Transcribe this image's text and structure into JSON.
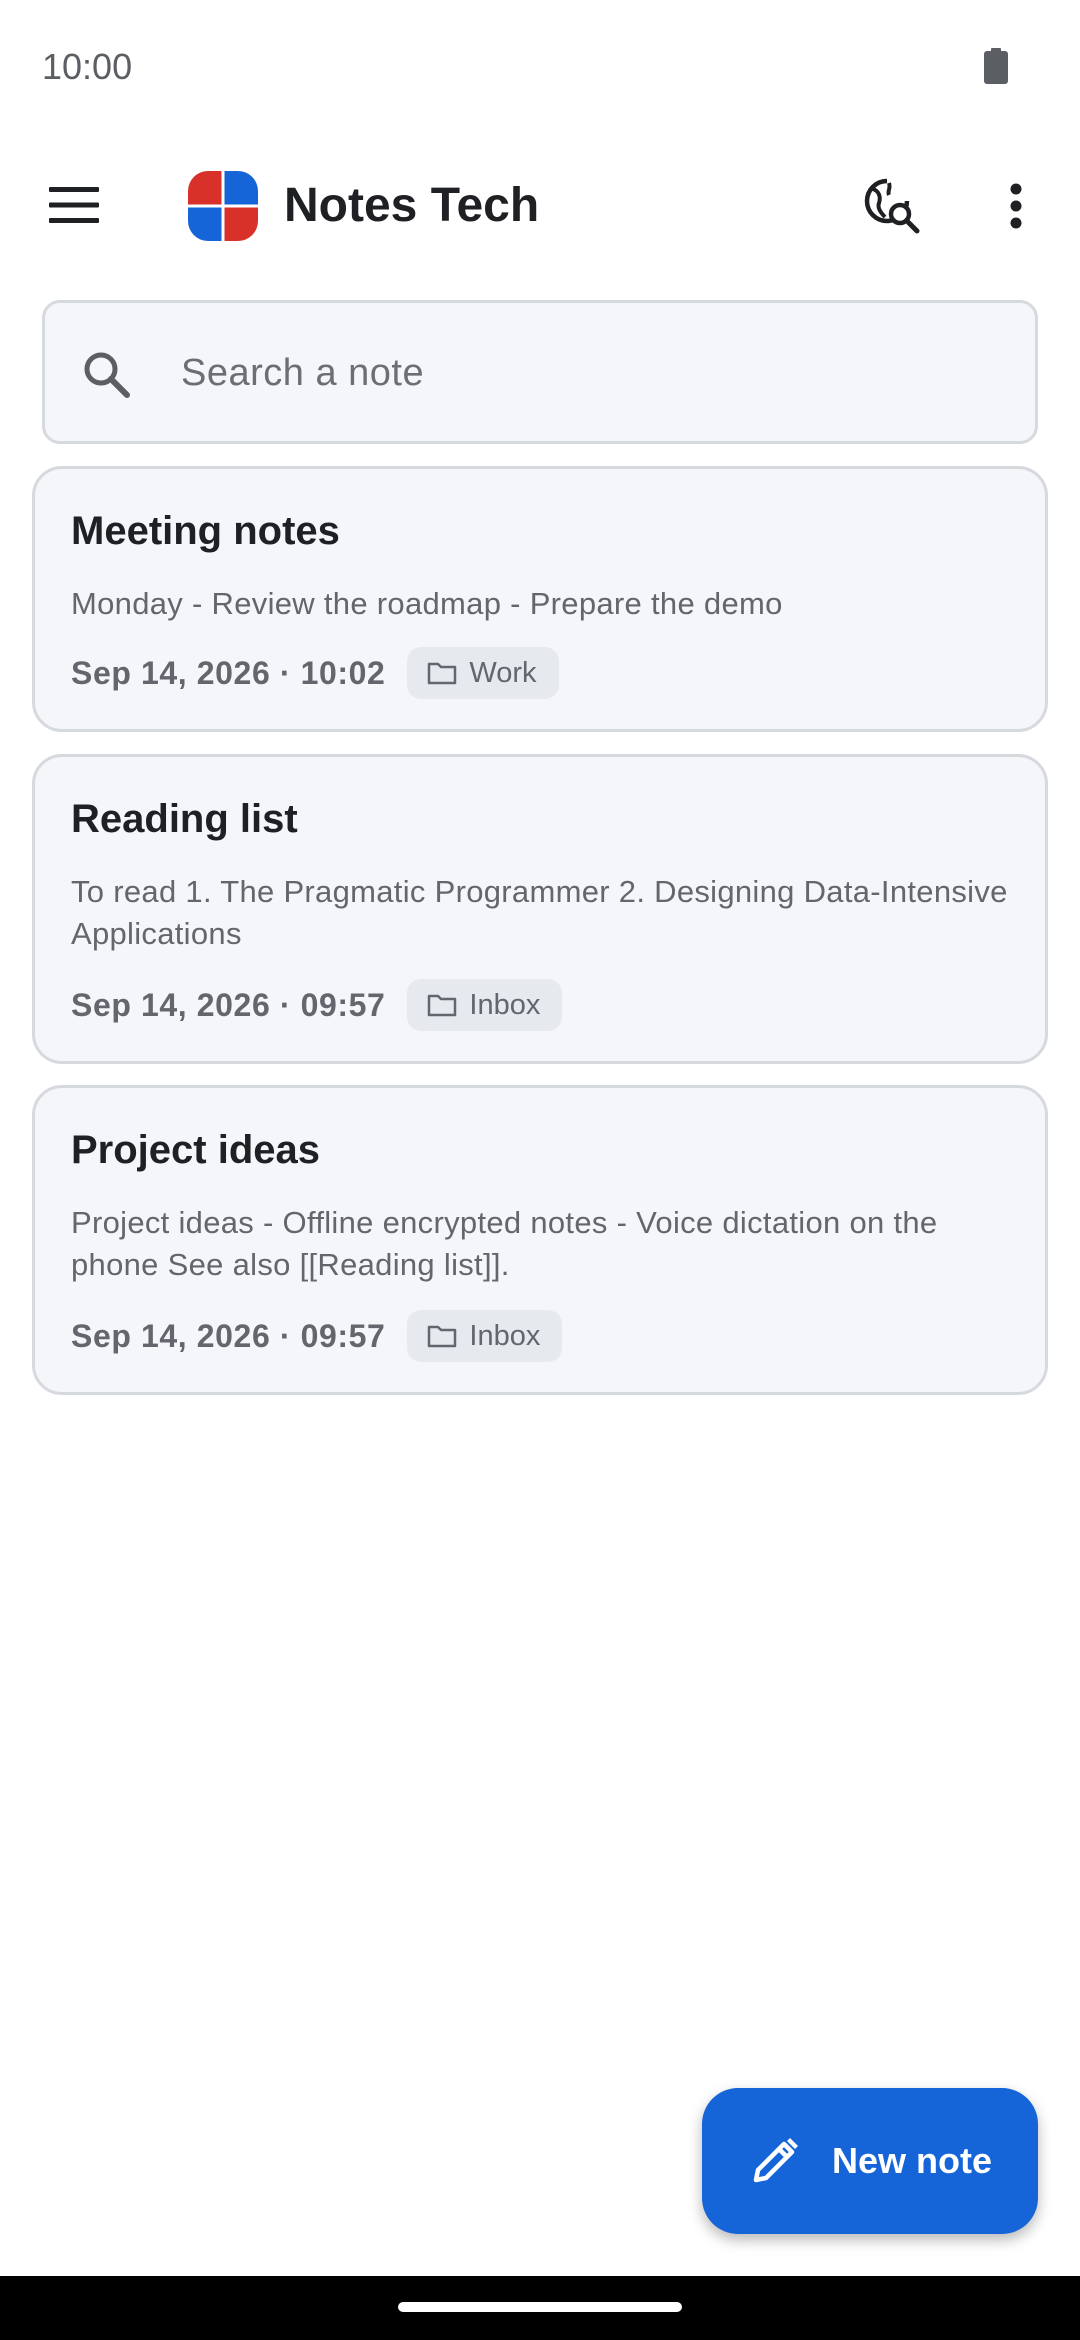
{
  "status_bar": {
    "time": "10:00",
    "icons": [
      "battery-icon"
    ]
  },
  "app_bar": {
    "title": "Notes Tech",
    "icons": [
      "menu-icon",
      "app-logo",
      "web-search-icon",
      "more-vert-icon"
    ],
    "logo_colors": [
      "#d8312a",
      "#1565d8"
    ]
  },
  "search": {
    "placeholder": "Search a note",
    "value": "",
    "icon": "search-icon"
  },
  "notes": [
    {
      "title": "Meeting notes",
      "preview": "Monday - Review the roadmap - Prepare the demo",
      "date": "Sep 14, 2026 · 10:02",
      "folder": "Work"
    },
    {
      "title": "Reading list",
      "preview": "To read 1. The Pragmatic Programmer 2. Designing Data-Intensive Applications",
      "date": "Sep 14, 2026 · 09:57",
      "folder": "Inbox"
    },
    {
      "title": "Project ideas",
      "preview": "Project ideas - Offline encrypted notes - Voice dictation on the phone See also [[Reading list]].",
      "date": "Sep 14, 2026 · 09:57",
      "folder": "Inbox"
    }
  ],
  "fab": {
    "label": "New note",
    "icon": "pencil-icon"
  },
  "colors": {
    "accent": "#1565d8",
    "card_background": "#f4f6f9",
    "card_border": "#d6d9de",
    "chip_background": "#e6e9ee"
  }
}
